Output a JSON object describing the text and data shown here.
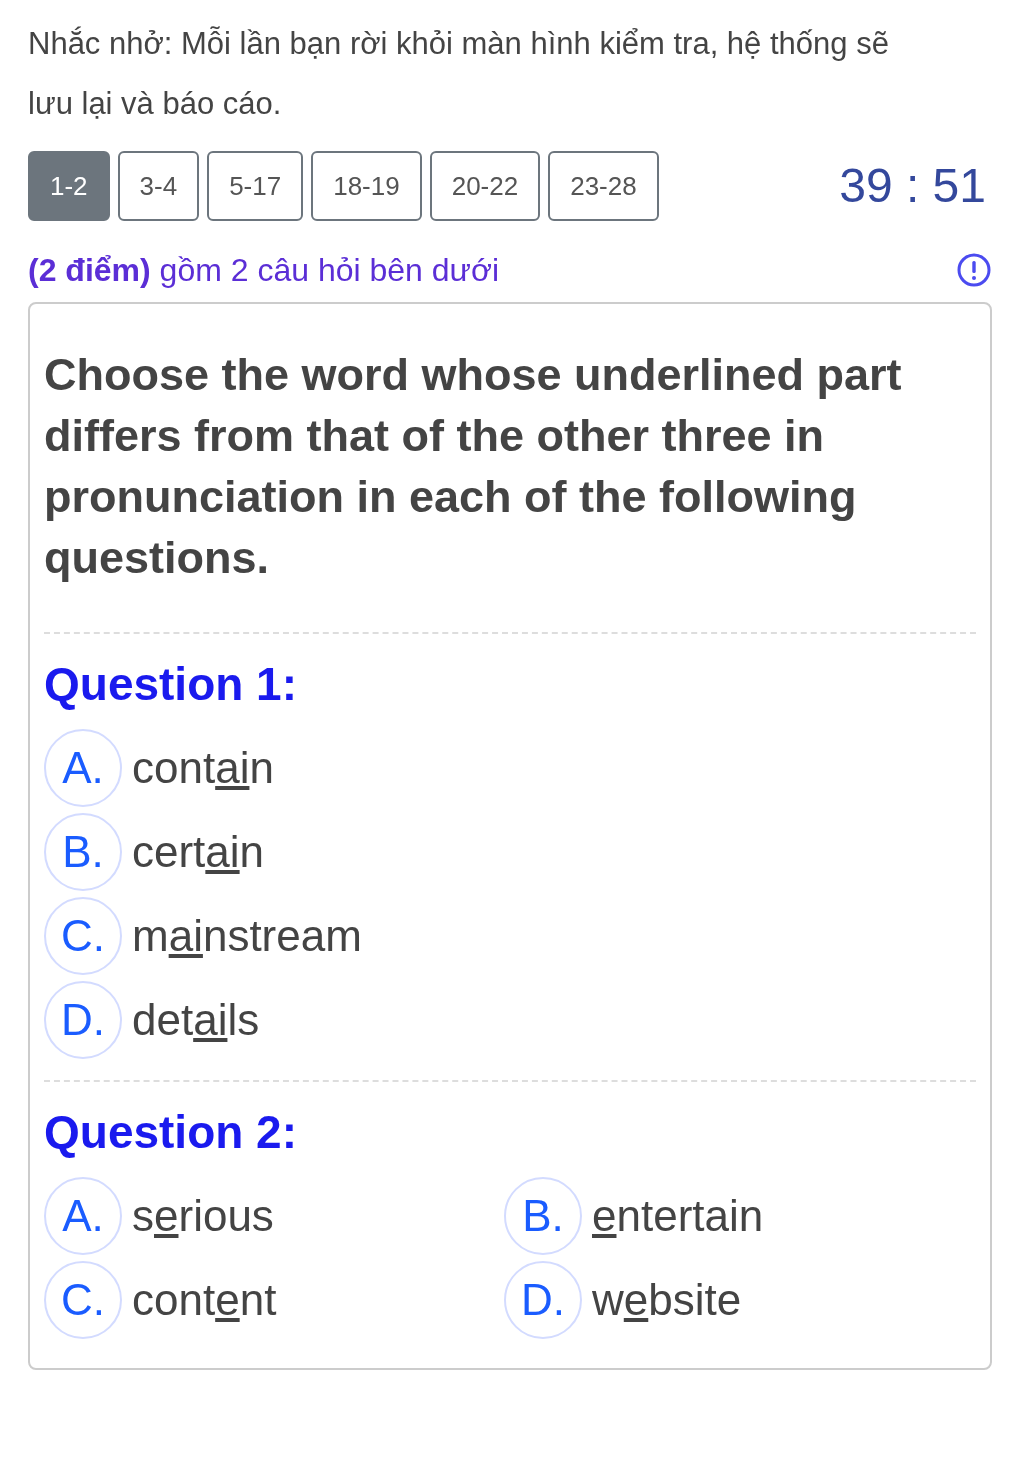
{
  "reminder": "Nhắc nhở: Mỗi lần bạn rời khỏi màn hình kiểm tra, hệ thống sẽ lưu lại và báo cáo.",
  "tabs": [
    {
      "label": "1-2",
      "selected": true
    },
    {
      "label": "3-4",
      "selected": false
    },
    {
      "label": "5-17",
      "selected": false
    },
    {
      "label": "18-19",
      "selected": false
    },
    {
      "label": "20-22",
      "selected": false
    },
    {
      "label": "23-28",
      "selected": false
    }
  ],
  "timer": "39 : 51",
  "section_heading": "**(2 điểm)** gồm 2 câu hỏi bên dưới",
  "instruction": "Choose the word whose underlined part differs from that of the other three in pronunciation in each of the following questions.",
  "questions": [
    {
      "title": "Question 1:",
      "kind": "list",
      "options": [
        {
          "letter": "A.",
          "before": "cont",
          "underlined": "ai",
          "after": "n"
        },
        {
          "letter": "B.",
          "before": "cert",
          "underlined": "ai",
          "after": "n"
        },
        {
          "letter": "C.",
          "before": "m",
          "underlined": "ai",
          "after": "nstream"
        },
        {
          "letter": "D.",
          "before": "det",
          "underlined": "ai",
          "after": "ls"
        }
      ]
    },
    {
      "title": "Question 2:",
      "kind": "grid",
      "options": [
        {
          "letter": "A.",
          "before": "s",
          "underlined": "e",
          "after": "rious"
        },
        {
          "letter": "B.",
          "underlined": "e",
          "after": "ntertain"
        },
        {
          "letter": "C.",
          "before": "cont",
          "underlined": "e",
          "after": "nt"
        },
        {
          "letter": "D.",
          "before": "w",
          "underlined": "e",
          "after": "bsite"
        }
      ]
    }
  ]
}
